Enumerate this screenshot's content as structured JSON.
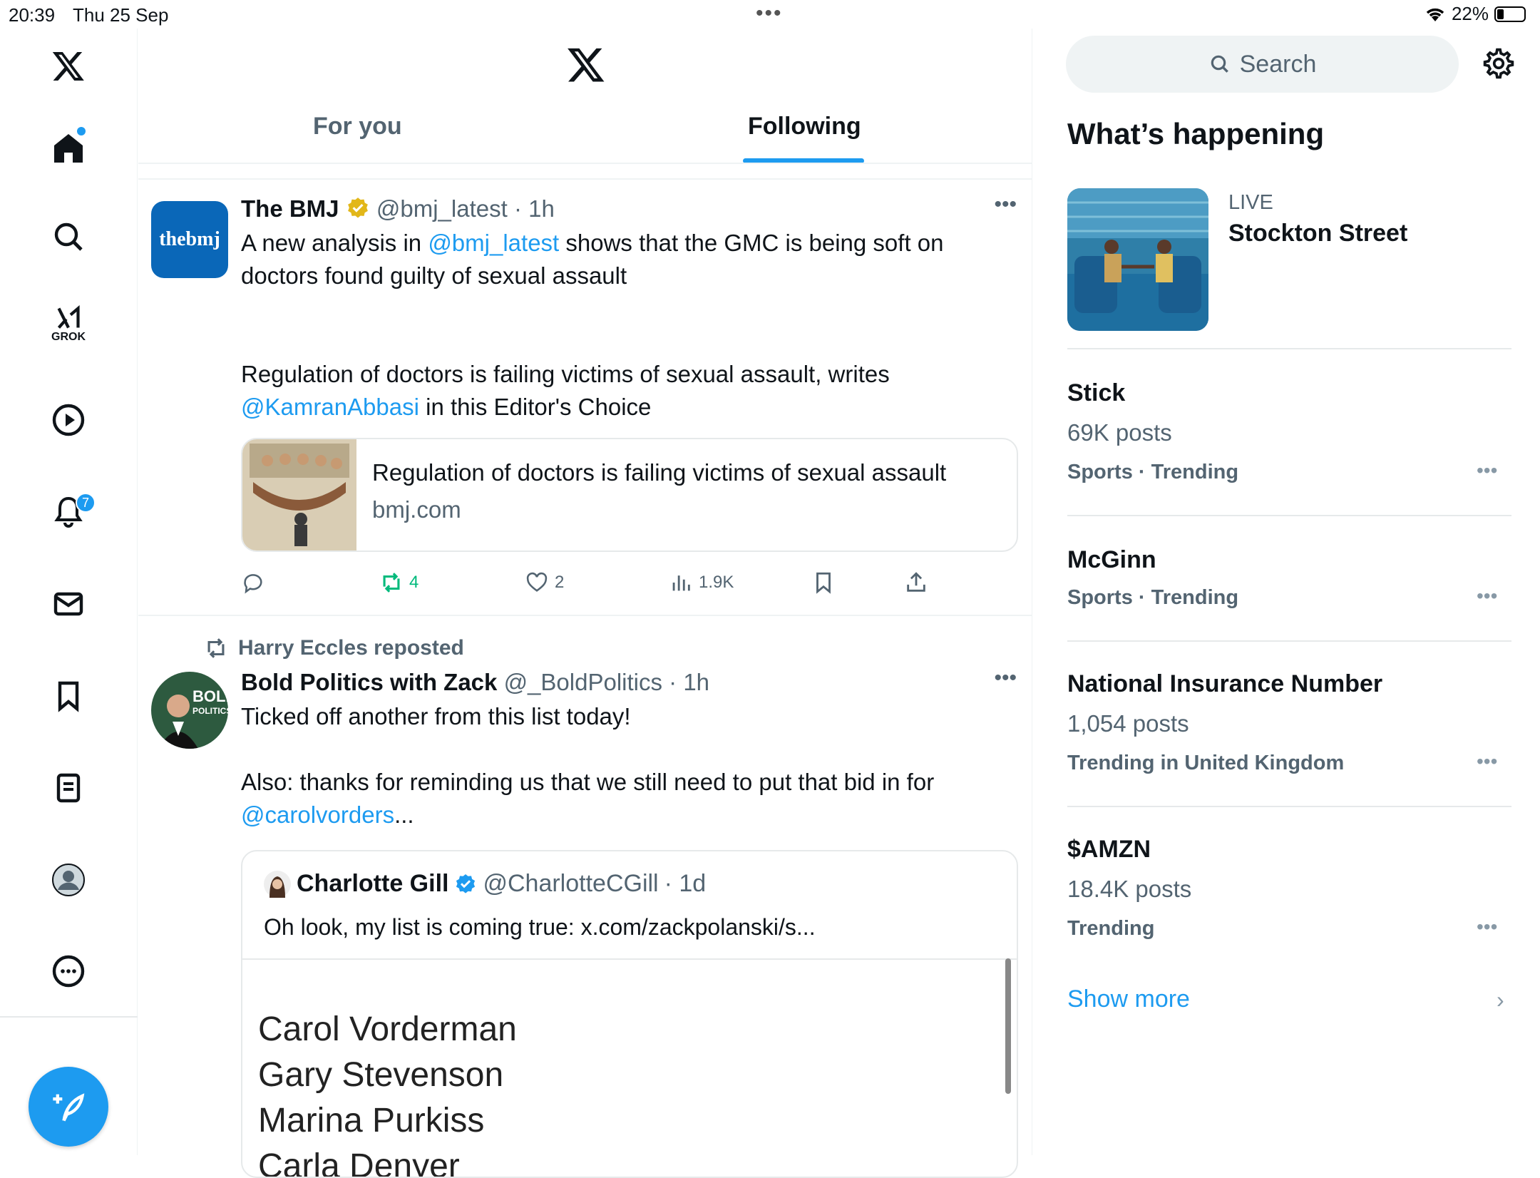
{
  "status": {
    "time": "20:39",
    "date": "Thu 25 Sep",
    "battery": "22%"
  },
  "nav": {
    "grok_label": "GROK",
    "notifications_count": "7"
  },
  "tabs": [
    {
      "label": "For you"
    },
    {
      "label": "Following"
    }
  ],
  "tweets": [
    {
      "name": "The BMJ",
      "handle": "@bmj_latest",
      "time": "· 1h",
      "avatar_text": "thebmj",
      "body1_pre": "A new analysis in ",
      "body1_link": "@bmj_latest",
      "body1_post": " shows that the GMC is being soft on doctors found guilty of sexual assault",
      "body2_pre": "Regulation of doctors is failing victims of sexual assault, writes ",
      "body2_link": "@KamranAbbasi",
      "body2_post": " in this Editor's Choice",
      "card_title": "Regulation of doctors is failing victims of sexual assault",
      "card_domain": "bmj.com",
      "reposts": "4",
      "likes": "2",
      "views": "1.9K"
    },
    {
      "reposted_by": "Harry Eccles reposted",
      "name": "Bold Politics with Zack",
      "handle": "@_BoldPolitics",
      "time": "· 1h",
      "avatar_text": "BOLD",
      "avatar_subtext": "POLITICS",
      "body1": "Ticked off another from this list today!",
      "body2_pre": "Also: thanks for reminding us that we still need to put that bid in for ",
      "body2_link": "@carolvorders",
      "body2_post": "...",
      "quote": {
        "name": "Charlotte Gill",
        "handle": "@CharlotteCGill",
        "time": "· 1d",
        "text": "Oh look, my list is coming true: x.com/zackpolanski/s...",
        "list": [
          "Carol Vorderman",
          "Gary Stevenson",
          "Marina Purkiss",
          "Carla Denyer"
        ]
      }
    }
  ],
  "sidebar": {
    "search_placeholder": "Search",
    "heading": "What’s happening",
    "live": {
      "tag": "LIVE",
      "title": "Stockton Street"
    },
    "trends": [
      {
        "title": "Stick",
        "posts": "69K posts",
        "category": "Sports · Trending"
      },
      {
        "title": "McGinn",
        "posts": "",
        "category": "Sports · Trending"
      },
      {
        "title": "National Insurance Number",
        "posts": "1,054 posts",
        "category": "Trending in United Kingdom"
      },
      {
        "title": "$AMZN",
        "posts": "18.4K posts",
        "category": "Trending"
      }
    ],
    "show_more": "Show more"
  },
  "colors": {
    "accent": "#1d9bf0",
    "repost_green": "#00ba7c",
    "secondary_text": "#536471"
  }
}
